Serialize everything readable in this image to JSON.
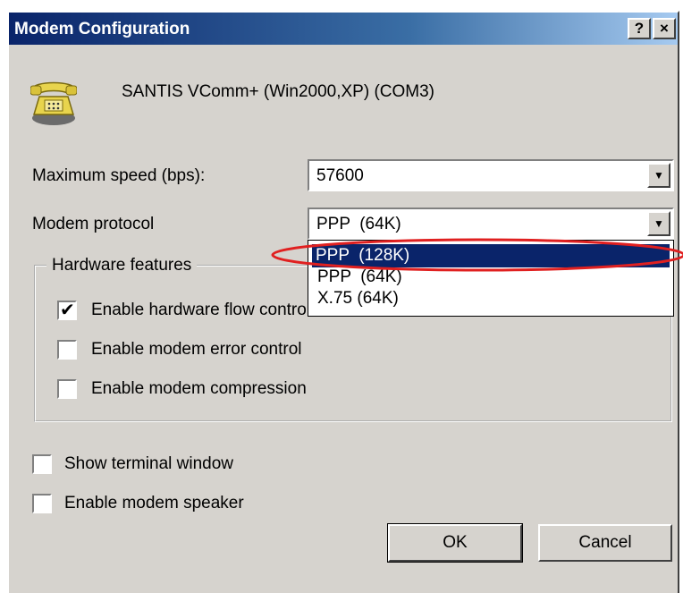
{
  "window": {
    "title": "Modem Configuration",
    "help_label": "?",
    "close_label": "×"
  },
  "device": {
    "icon": "telephone-modem-icon",
    "name": "SANTIS VComm+ (Win2000,XP) (COM3)"
  },
  "fields": {
    "speed_label": "Maximum speed (bps):",
    "speed_value": "57600",
    "protocol_label": "Modem protocol",
    "protocol_value": "PPP  (64K)"
  },
  "protocol_dropdown": {
    "options": [
      "PPP  (128K)",
      "PPP  (64K)",
      "X.75 (64K)"
    ],
    "highlighted_index": 0
  },
  "hardware": {
    "legend": "Hardware features",
    "flow_control": {
      "label": "Enable hardware flow control",
      "checked": true
    },
    "error_control": {
      "label": "Enable modem error control",
      "checked": false
    },
    "compression": {
      "label": "Enable modem compression",
      "checked": false
    }
  },
  "options": {
    "terminal": {
      "label": "Show terminal window",
      "checked": false
    },
    "speaker": {
      "label": "Enable modem speaker",
      "checked": false
    }
  },
  "buttons": {
    "ok": "OK",
    "cancel": "Cancel"
  },
  "colors": {
    "title_bar": "#0a246a",
    "selection": "#0a246a",
    "annotation": "#e02020",
    "face": "#d6d3ce"
  }
}
